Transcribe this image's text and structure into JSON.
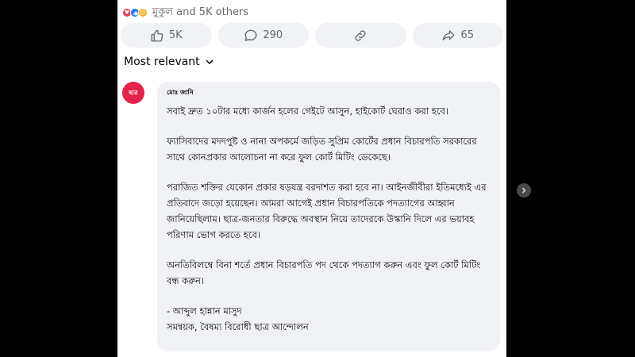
{
  "reactions": {
    "icons": [
      "love-icon",
      "like-icon",
      "care-icon"
    ],
    "summary": "মুকুল and 5K others"
  },
  "actions": {
    "like_count": "5K",
    "comment_count": "290",
    "share_count": "65"
  },
  "comments_sort": {
    "label": "Most relevant"
  },
  "comment": {
    "avatar_text": "ছাত্র",
    "author": "মোঃ জানি",
    "paragraphs": [
      "সবাই দ্রুত ১০টার মধ্যে কার্জন হলের গেইটে আসুন, হাইকোর্ট ঘেরাও করা হবে।",
      "ফ্যাসিবাদের মদদপুষ্ট ও নানা অপকর্মে জড়িত সুপ্রিম কোর্টের প্রধান বিচারপতি সরকারের সাথে কোনপ্রকার আলোচনা না করে ফুল কোর্ট মিটিং ডেকেছে।",
      "পরাজিত শক্তির যেকোন প্রকার ষড়যন্ত্র বরদাশত করা হবে না। আইনজীবীরা ইতিমধ্যেই এর প্রতিবাদে জড়ো হয়েছেন। আমরা আগেই প্রধান বিচারপতিকে পদত্যাগের আহ্বান জানিয়েছিলাম। ছাত্র-জনতার বিরুদ্ধে অবস্থান নিয়ে তাদেরকে উস্কানি দিলে এর ভয়াবহ পরিণাম ভোগ করতে হবে।",
      "অনতিবিলম্বে বিনা শর্তে প্রধান বিচারপতি পদ থেকে পদত্যাগ করুন এবং ফুল কোর্ট মিটিং বন্ধ করুন।"
    ],
    "signature_name": "- আব্দুল হান্নান মাসুদ",
    "signature_title": "সমন্বয়ক, বৈষম্য বিরোধী ছাত্র আন্দোলন"
  },
  "colors": {
    "panel_bg": "#ffffff",
    "outer_bg": "#000000",
    "bubble_bg": "#f0f2f5",
    "avatar_bg": "#e4234a"
  }
}
